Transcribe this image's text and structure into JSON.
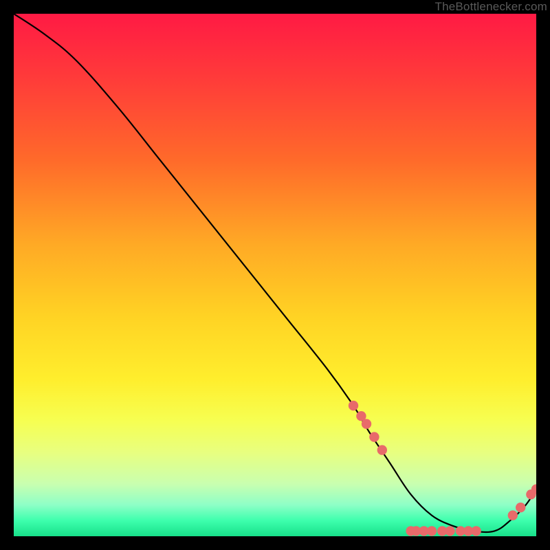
{
  "credit": {
    "label": "TheBottlenecker.com"
  },
  "colors": {
    "line": "#000000",
    "marker_fill": "#e86a6a",
    "marker_stroke": "#d85a5a"
  },
  "chart_data": {
    "type": "line",
    "title": "",
    "xlabel": "",
    "ylabel": "",
    "xlim": [
      0,
      100
    ],
    "ylim": [
      0,
      100
    ],
    "series": [
      {
        "name": "curve",
        "x": [
          0,
          6,
          12,
          20,
          28,
          36,
          44,
          52,
          60,
          65,
          68,
          72,
          76,
          80,
          84,
          88,
          92,
          95,
          98,
          100
        ],
        "y": [
          100,
          96,
          91,
          82,
          72,
          62,
          52,
          42,
          32,
          25,
          20,
          14,
          8,
          4,
          2,
          1,
          1,
          3,
          6,
          9
        ]
      }
    ],
    "markers": [
      {
        "x": 65.0,
        "y": 25.0
      },
      {
        "x": 66.5,
        "y": 23.0
      },
      {
        "x": 67.5,
        "y": 21.5
      },
      {
        "x": 69.0,
        "y": 19.0
      },
      {
        "x": 70.5,
        "y": 16.5
      },
      {
        "x": 76.0,
        "y": 1.0
      },
      {
        "x": 77.0,
        "y": 1.0
      },
      {
        "x": 78.5,
        "y": 1.0
      },
      {
        "x": 80.0,
        "y": 1.0
      },
      {
        "x": 82.0,
        "y": 1.0
      },
      {
        "x": 83.5,
        "y": 1.0
      },
      {
        "x": 85.5,
        "y": 1.0
      },
      {
        "x": 87.0,
        "y": 1.0
      },
      {
        "x": 88.5,
        "y": 1.0
      },
      {
        "x": 95.5,
        "y": 4.0
      },
      {
        "x": 97.0,
        "y": 5.5
      },
      {
        "x": 99.0,
        "y": 8.0
      },
      {
        "x": 100.0,
        "y": 9.0
      }
    ]
  }
}
